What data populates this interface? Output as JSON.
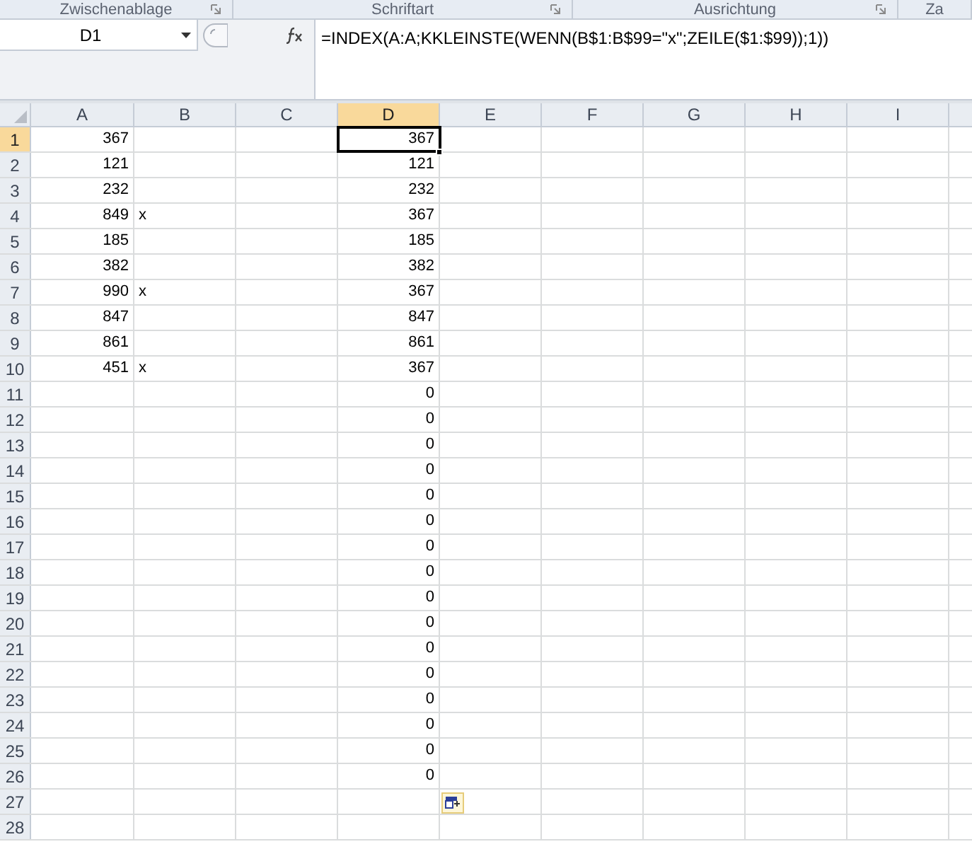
{
  "ribbon_groups": [
    {
      "label": "Zwischenablage"
    },
    {
      "label": "Schriftart"
    },
    {
      "label": "Ausrichtung"
    },
    {
      "label": "Za"
    }
  ],
  "name_box": {
    "value": "D1"
  },
  "formula_bar": {
    "value": "=INDEX(A:A;KKLEINSTE(WENN(B$1:B$99=\"x\";ZEILE($1:$99));1))"
  },
  "columns": [
    {
      "label": "A",
      "selected": false
    },
    {
      "label": "B",
      "selected": false
    },
    {
      "label": "C",
      "selected": false
    },
    {
      "label": "D",
      "selected": true
    },
    {
      "label": "E",
      "selected": false
    },
    {
      "label": "F",
      "selected": false
    },
    {
      "label": "G",
      "selected": false
    },
    {
      "label": "H",
      "selected": false
    },
    {
      "label": "I",
      "selected": false
    }
  ],
  "rows": [
    {
      "header": "1",
      "selected": true,
      "a": "367",
      "d": "367"
    },
    {
      "header": "2",
      "selected": false,
      "a": "121",
      "d": "121"
    },
    {
      "header": "3",
      "selected": false,
      "a": "232",
      "d": "232"
    },
    {
      "header": "4",
      "selected": false,
      "a": "849",
      "b": "x",
      "d": "367"
    },
    {
      "header": "5",
      "selected": false,
      "a": "185",
      "d": "185"
    },
    {
      "header": "6",
      "selected": false,
      "a": "382",
      "d": "382"
    },
    {
      "header": "7",
      "selected": false,
      "a": "990",
      "b": "x",
      "d": "367"
    },
    {
      "header": "8",
      "selected": false,
      "a": "847",
      "d": "847"
    },
    {
      "header": "9",
      "selected": false,
      "a": "861",
      "d": "861"
    },
    {
      "header": "10",
      "selected": false,
      "a": "451",
      "b": "x",
      "d": "367"
    },
    {
      "header": "11",
      "selected": false,
      "d": "0"
    },
    {
      "header": "12",
      "selected": false,
      "d": "0"
    },
    {
      "header": "13",
      "selected": false,
      "d": "0"
    },
    {
      "header": "14",
      "selected": false,
      "d": "0"
    },
    {
      "header": "15",
      "selected": false,
      "d": "0"
    },
    {
      "header": "16",
      "selected": false,
      "d": "0"
    },
    {
      "header": "17",
      "selected": false,
      "d": "0"
    },
    {
      "header": "18",
      "selected": false,
      "d": "0"
    },
    {
      "header": "19",
      "selected": false,
      "d": "0"
    },
    {
      "header": "20",
      "selected": false,
      "d": "0"
    },
    {
      "header": "21",
      "selected": false,
      "d": "0"
    },
    {
      "header": "22",
      "selected": false,
      "d": "0"
    },
    {
      "header": "23",
      "selected": false,
      "d": "0"
    },
    {
      "header": "24",
      "selected": false,
      "d": "0"
    },
    {
      "header": "25",
      "selected": false,
      "d": "0"
    },
    {
      "header": "26",
      "selected": false,
      "d": "0"
    },
    {
      "header": "27",
      "selected": false
    },
    {
      "header": "28",
      "selected": false
    }
  ]
}
